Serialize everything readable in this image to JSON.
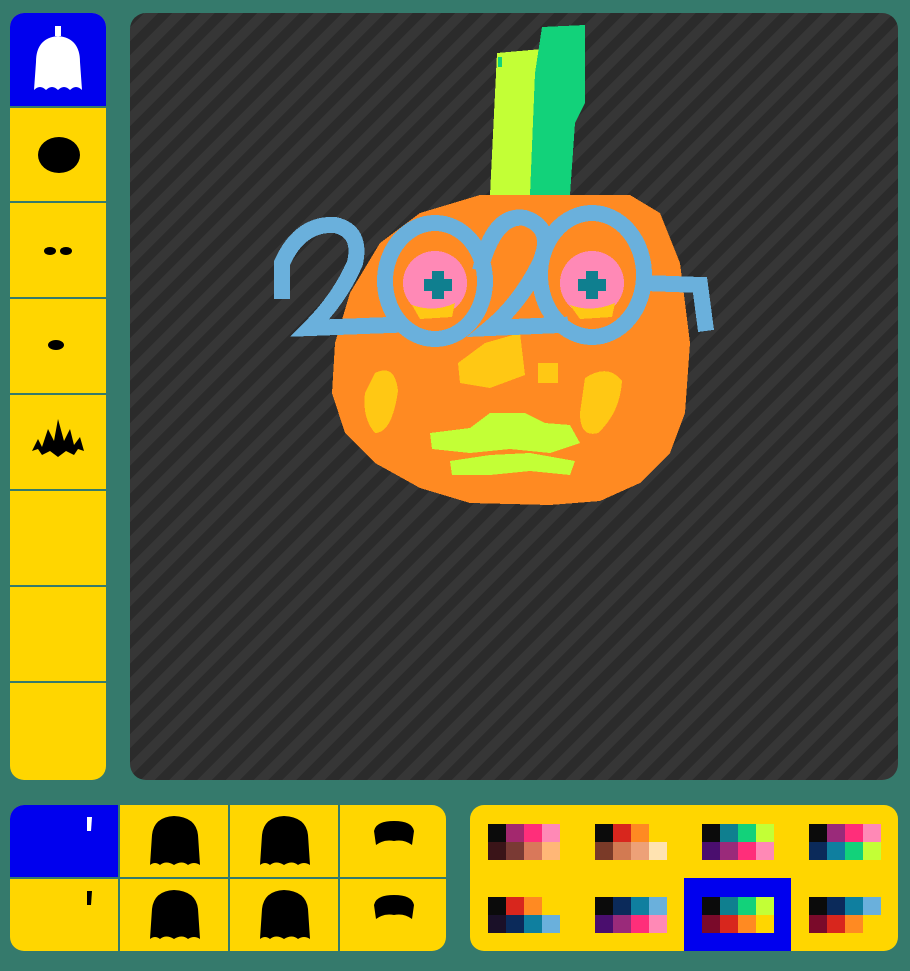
{
  "categories": [
    {
      "name": "head",
      "icon": "pumpkin-head-icon",
      "selected": true
    },
    {
      "name": "eyes",
      "icon": "eye-blob-icon",
      "selected": false
    },
    {
      "name": "nose",
      "icon": "nose-dots-icon",
      "selected": false
    },
    {
      "name": "mouth",
      "icon": "mouth-blob-icon",
      "selected": false
    },
    {
      "name": "hair",
      "icon": "spiky-hair-icon",
      "selected": false
    },
    {
      "name": "empty-1",
      "icon": "",
      "selected": false
    },
    {
      "name": "empty-2",
      "icon": "",
      "selected": false
    },
    {
      "name": "empty-3",
      "icon": "",
      "selected": false
    }
  ],
  "shapes": [
    {
      "icon": "stem-thin-icon",
      "selected": true
    },
    {
      "icon": "pumpkin-round-icon",
      "selected": false
    },
    {
      "icon": "pumpkin-round-icon",
      "selected": false
    },
    {
      "icon": "pumpkin-flat-icon",
      "selected": false
    },
    {
      "icon": "stem-short-icon",
      "selected": false
    },
    {
      "icon": "pumpkin-round-icon",
      "selected": false
    },
    {
      "icon": "pumpkin-round-icon",
      "selected": false
    },
    {
      "icon": "pumpkin-flat-icon",
      "selected": false
    }
  ],
  "palettes": [
    {
      "colors": [
        "#0b0b0b",
        "#a3286e",
        "#ff2e7a",
        "#ff89b6",
        "#3a1418",
        "#7a3a34",
        "#d9785a",
        "#ffb777"
      ],
      "selected": false
    },
    {
      "colors": [
        "#0b0b0b",
        "#d8261d",
        "#ff8a22",
        "#ffd600",
        "#7a3a28",
        "#d27a52",
        "#eda178",
        "#ffe3b1"
      ],
      "selected": false
    },
    {
      "colors": [
        "#0b0b0b",
        "#0f7f8f",
        "#12d27a",
        "#c3ff36",
        "#4a0e6e",
        "#9a2a7a",
        "#ff2e7a",
        "#ff89b6"
      ],
      "selected": false
    },
    {
      "colors": [
        "#0b0b0b",
        "#9a2a7a",
        "#ff2e7a",
        "#ff89b6",
        "#0b2a5a",
        "#0f7f9f",
        "#12d27a",
        "#c3ff36"
      ],
      "selected": false
    },
    {
      "colors": [
        "#0b0b0b",
        "#d8261d",
        "#ff8a22",
        "#ffd600",
        "#1a1028",
        "#0b2a5a",
        "#0f7f9f",
        "#6ab0dc"
      ],
      "selected": false
    },
    {
      "colors": [
        "#0b0b0b",
        "#0b2a5a",
        "#0f7f9f",
        "#6ab0dc",
        "#4a0e6e",
        "#9a2a7a",
        "#ff2e7a",
        "#ff89b6"
      ],
      "selected": false
    },
    {
      "colors": [
        "#0b0b0b",
        "#0f7f8f",
        "#12d27a",
        "#c3ff36",
        "#7a0a2a",
        "#d8261d",
        "#ff8a22",
        "#ffd600"
      ],
      "selected": true
    },
    {
      "colors": [
        "#0b0b0b",
        "#0b2a5a",
        "#0f7f9f",
        "#6ab0dc",
        "#7a0a2a",
        "#d8261d",
        "#ff8a22",
        "#ffd600"
      ],
      "selected": false
    }
  ],
  "colors": {
    "background": "#357a6c",
    "panel": "#ffd600",
    "selected": "#0000ee",
    "pumpkin": "#ff8a22",
    "cheek": "#ffc814",
    "stem_light": "#c3ff36",
    "stem_dark": "#12d27a",
    "glasses": "#6ab0dc",
    "eye_ring": "#ff89b6",
    "pupil": "#0f7f8f",
    "mouth": "#c3ff36"
  }
}
